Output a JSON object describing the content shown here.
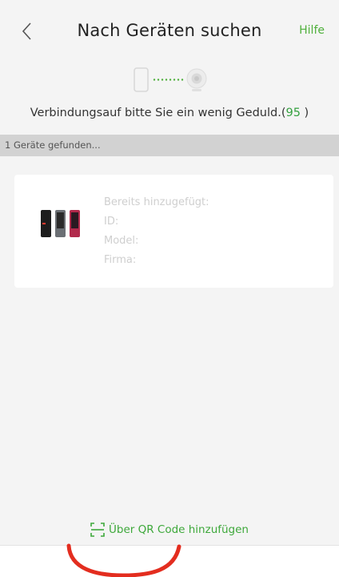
{
  "header": {
    "title": "Nach Geräten suchen",
    "help_label": "Hilfe"
  },
  "status": {
    "message": "Verbindungsauf bitte Sie ein wenig Geduld.(",
    "countdown": "95",
    "closing": " )"
  },
  "found_bar": {
    "text": "1 Geräte gefunden..."
  },
  "device_card": {
    "already_added": "Bereits hinzugefügt:",
    "id": "ID:",
    "model": "Model:",
    "company": "Firma:"
  },
  "footer": {
    "qr_label": "Über QR Code hinzufügen"
  },
  "colors": {
    "accent": "#4fb03c",
    "annotation": "#e32d1f"
  }
}
